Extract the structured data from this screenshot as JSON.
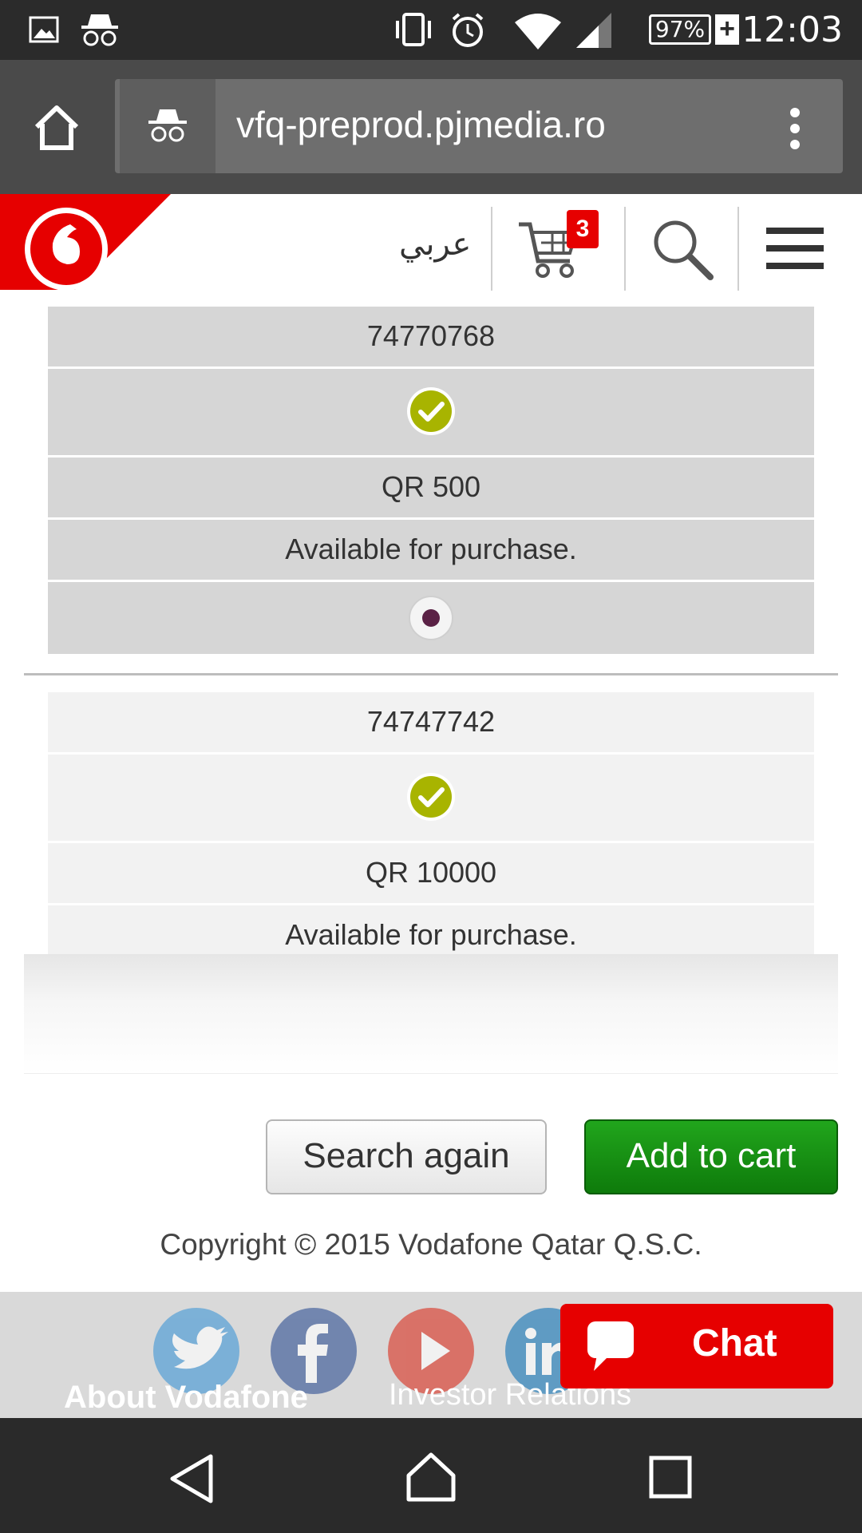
{
  "status_bar": {
    "time": "12:03",
    "battery_percent": "97%",
    "icons": [
      "gallery-icon",
      "incognito-icon",
      "vibrate-icon",
      "alarm-icon",
      "wifi-icon",
      "signal-icon",
      "battery-icon"
    ]
  },
  "browser": {
    "url": "vfq-preprod.pjmedia.ro",
    "icons": [
      "home-icon",
      "incognito-icon",
      "more-vert-icon"
    ]
  },
  "header": {
    "language_link": "عربي",
    "cart_count": "3",
    "icons": [
      "vodafone-logo",
      "cart-icon",
      "search-icon",
      "menu-icon"
    ],
    "brand_color": "#e60000"
  },
  "results": [
    {
      "number": "74770768",
      "price": "QR 500",
      "status": "Available for purchase.",
      "selected": true
    },
    {
      "number": "74747742",
      "price": "QR 10000",
      "status": "Available for purchase."
    }
  ],
  "actions": {
    "search_again": "Search again",
    "add_to_cart": "Add to cart"
  },
  "footer": {
    "copyright": "Copyright © 2015 Vodafone Qatar Q.S.C.",
    "about": "About Vodafone",
    "investor": "Investor Relations",
    "social": [
      "twitter-icon",
      "facebook-icon",
      "youtube-icon",
      "linkedin-icon"
    ],
    "chat_label": "Chat"
  },
  "colors": {
    "check_green": "#a8b400",
    "radio_purple": "#5a2145",
    "add_to_cart_green": "#168f12",
    "chat_red": "#e60000"
  }
}
